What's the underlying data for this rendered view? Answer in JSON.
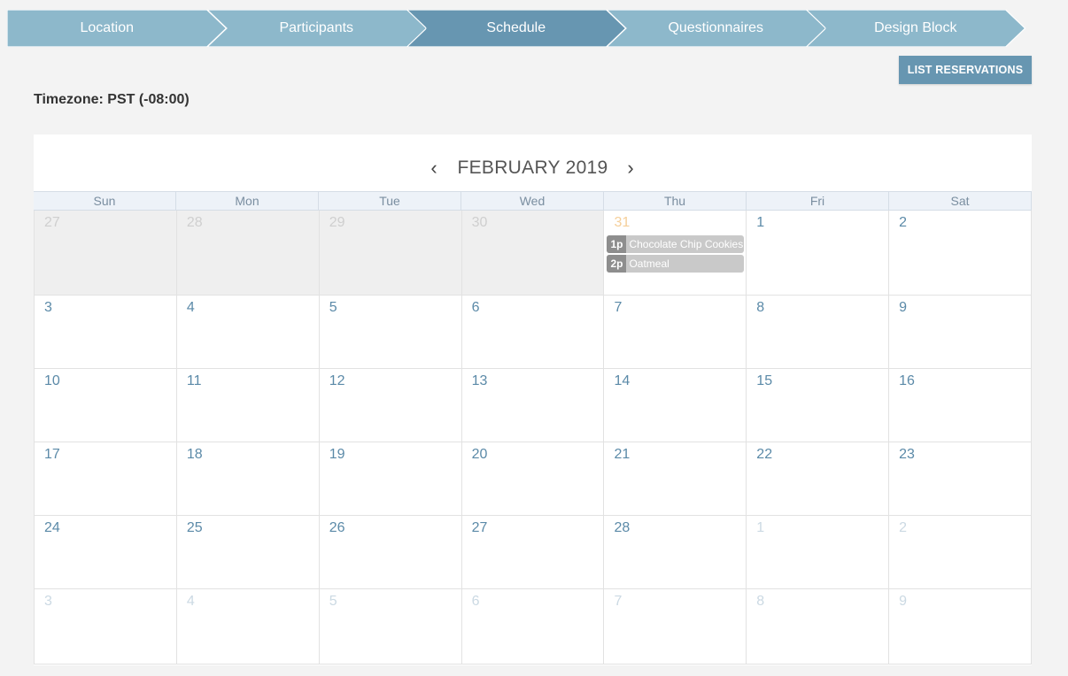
{
  "wizard": {
    "steps": [
      {
        "label": "Location",
        "active": false
      },
      {
        "label": "Participants",
        "active": false
      },
      {
        "label": "Schedule",
        "active": true
      },
      {
        "label": "Questionnaires",
        "active": false
      },
      {
        "label": "Design Block",
        "active": false
      }
    ],
    "colors": {
      "inactive": "#8db8cb",
      "active": "#6796b1"
    }
  },
  "toolbar": {
    "list_reservations_label": "LIST RESERVATIONS"
  },
  "timezone": "Timezone: PST (-08:00)",
  "calendar": {
    "title": "FEBRUARY 2019",
    "prev_label": "‹",
    "next_label": "›",
    "weekdays": [
      "Sun",
      "Mon",
      "Tue",
      "Wed",
      "Thu",
      "Fri",
      "Sat"
    ],
    "weeks": [
      [
        {
          "n": "27",
          "type": "past"
        },
        {
          "n": "28",
          "type": "past"
        },
        {
          "n": "29",
          "type": "past"
        },
        {
          "n": "30",
          "type": "past"
        },
        {
          "n": "31",
          "type": "today",
          "events": [
            {
              "time": "1p",
              "title": "Chocolate Chip Cookies"
            },
            {
              "time": "2p",
              "title": "Oatmeal"
            }
          ]
        },
        {
          "n": "1",
          "type": "current"
        },
        {
          "n": "2",
          "type": "current"
        }
      ],
      [
        {
          "n": "3",
          "type": "current"
        },
        {
          "n": "4",
          "type": "current"
        },
        {
          "n": "5",
          "type": "current"
        },
        {
          "n": "6",
          "type": "current"
        },
        {
          "n": "7",
          "type": "current"
        },
        {
          "n": "8",
          "type": "current"
        },
        {
          "n": "9",
          "type": "current"
        }
      ],
      [
        {
          "n": "10",
          "type": "current"
        },
        {
          "n": "11",
          "type": "current"
        },
        {
          "n": "12",
          "type": "current"
        },
        {
          "n": "13",
          "type": "current"
        },
        {
          "n": "14",
          "type": "current"
        },
        {
          "n": "15",
          "type": "current"
        },
        {
          "n": "16",
          "type": "current"
        }
      ],
      [
        {
          "n": "17",
          "type": "current"
        },
        {
          "n": "18",
          "type": "current"
        },
        {
          "n": "19",
          "type": "current"
        },
        {
          "n": "20",
          "type": "current"
        },
        {
          "n": "21",
          "type": "current"
        },
        {
          "n": "22",
          "type": "current"
        },
        {
          "n": "23",
          "type": "current"
        }
      ],
      [
        {
          "n": "24",
          "type": "current"
        },
        {
          "n": "25",
          "type": "current"
        },
        {
          "n": "26",
          "type": "current"
        },
        {
          "n": "27",
          "type": "current"
        },
        {
          "n": "28",
          "type": "current"
        },
        {
          "n": "1",
          "type": "other"
        },
        {
          "n": "2",
          "type": "other"
        }
      ],
      [
        {
          "n": "3",
          "type": "other"
        },
        {
          "n": "4",
          "type": "other"
        },
        {
          "n": "5",
          "type": "other"
        },
        {
          "n": "6",
          "type": "other"
        },
        {
          "n": "7",
          "type": "other"
        },
        {
          "n": "8",
          "type": "other"
        },
        {
          "n": "9",
          "type": "other"
        }
      ]
    ]
  }
}
